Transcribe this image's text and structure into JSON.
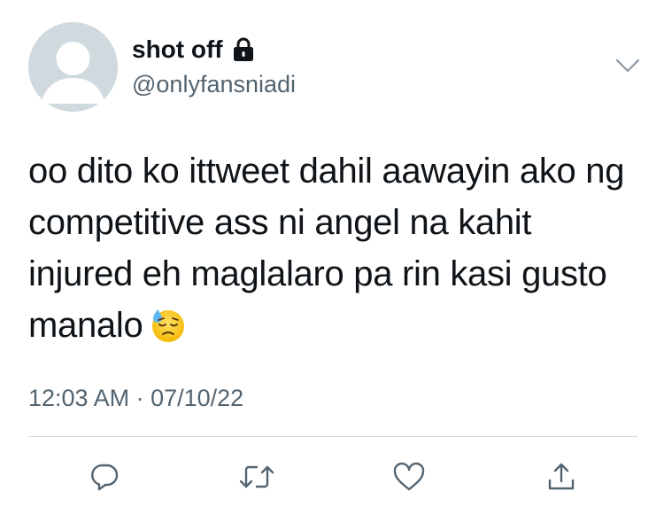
{
  "user": {
    "display_name": "shot off",
    "handle": "@onlyfansniadi",
    "protected_icon": "lock-icon",
    "avatar": "default-avatar"
  },
  "tweet": {
    "lines": [
      "oo dito ko ittweet dahil aawayin ako ng",
      "competitive ass ni angel na kahit",
      "injured eh maglalaro pa rin kasi gusto",
      "manalo"
    ],
    "emoji": "downcast-face-with-sweat-emoji",
    "timestamp": "12:03 AM · 07/10/22"
  },
  "actions": [
    "reply-icon",
    "retweet-icon",
    "like-icon",
    "share-icon"
  ],
  "colors": {
    "text": "#0f1419",
    "secondary": "#536471",
    "avatar_bg": "#cfd9de",
    "divider": "#cfd9de"
  }
}
